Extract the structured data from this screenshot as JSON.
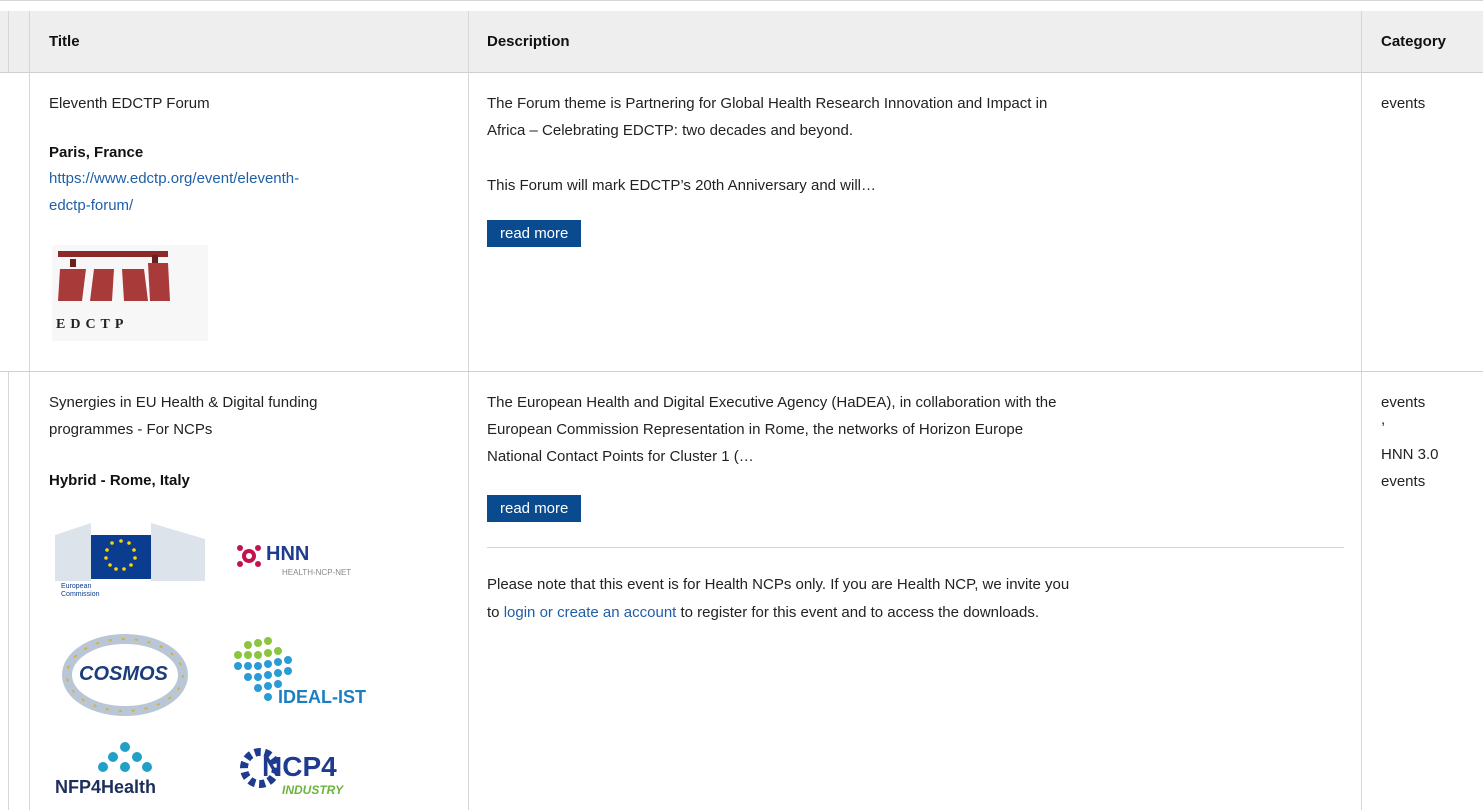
{
  "table": {
    "headers": {
      "title": "Title",
      "description": "Description",
      "category": "Category"
    }
  },
  "rows": [
    {
      "title": "Eleventh EDCTP Forum",
      "location": "Paris, France",
      "link": "https://www.edctp.org/event/eleventh-edctp-forum/",
      "link_line1": "https://www.edctp.org/event/eleventh-",
      "link_line2": "edctp-forum/",
      "logo_text": "EDCTP",
      "desc_p1_line1": "The Forum theme is Partnering for Global Health Research Innovation and Impact in",
      "desc_p1_line2": "Africa – Celebrating EDCTP: two decades and beyond.",
      "desc_p2": "This Forum will mark EDCTP’s 20th Anniversary and will…",
      "read_more": "read more",
      "category": "events"
    },
    {
      "title_line1": "Synergies in EU Health & Digital funding",
      "title_line2": "programmes - For NCPs",
      "location": "Hybrid - Rome, Italy",
      "logos": {
        "ec": "European Commission",
        "hnn": "HNN",
        "hnn_sub": "HEALTH-NCP-NET",
        "cosmos": "COSMOS",
        "ideal": "IDEAL-IST",
        "nfp": "NFP4Health",
        "ncp": "NCP4",
        "ncp_sub": "INDUSTRY"
      },
      "desc_line1": "The European Health and Digital Executive Agency (HaDEA), in collaboration with the",
      "desc_line2": "European Commission Representation in Rome, the networks of Horizon Europe",
      "desc_line3": "National Contact Points for Cluster 1 (…",
      "read_more": "read more",
      "note_line1": "Please note that this event is for Health NCPs only. If you are Health NCP, we invite you",
      "note_to": "to",
      "note_login": "login",
      "note_or": "or",
      "note_create": "create an account",
      "note_rest": "to register for this event and to access the downloads.",
      "category_1": "events",
      "category_sep": ",",
      "category_2": "HNN 3.0",
      "category_3": "events"
    }
  ],
  "colors": {
    "header_bg": "#eeeeee",
    "button_bg": "#0a4a8f",
    "link": "#1f5fa8"
  }
}
